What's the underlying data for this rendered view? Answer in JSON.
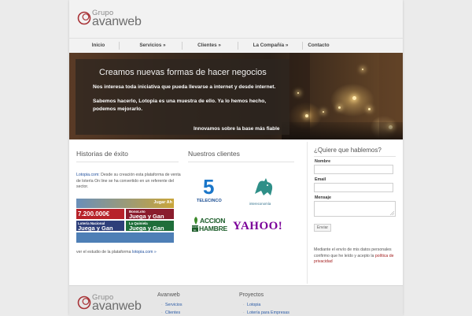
{
  "brand": {
    "line1": "Grupo",
    "line2": "avanweb"
  },
  "nav": [
    {
      "label": "Inicio"
    },
    {
      "label": "Servicios »"
    },
    {
      "label": "Clientes »"
    },
    {
      "label": "La Compañía »"
    },
    {
      "label": "Contacto"
    }
  ],
  "banner": {
    "title": "Creamos nuevas formas de hacer negocios",
    "line1": "Nos interesa toda iniciativa que pueda llevarse a internet y desde internet.",
    "line2": "Sabemos hacerlo, Lotopia es una muestra de ello. Ya lo hemos hecho,",
    "line3": "podemos mejorarlo.",
    "tagline": "Innovamos sobre la base más fiable"
  },
  "historias": {
    "heading": "Historias de éxito",
    "link": "Lotopia.com:",
    "text": " Desde su creación esta plataforma de venta de lotería On line se ha convertido en un referente del sector.",
    "tiles": {
      "t1": "Jugar Ah",
      "t2": "7.200.000€",
      "t3": "BonoLoto",
      "t4": "Juega y Gan",
      "t5": "Lotería Nacional",
      "t6": "Juega y Gan",
      "t7": "La Quiniela",
      "t8": "Juega y Gan"
    },
    "more_text": "ver el estudio de la plataforma ",
    "more_link": "lotopia.com »"
  },
  "clientes": {
    "heading": "Nuestros clientes",
    "logos": {
      "telecinco": "TELECINCO",
      "telecinco_num": "5",
      "intereconomia": "intereconomía",
      "accion": "ACCION",
      "hambre_prefix": "CONTRA EL",
      "hambre": "HAMBRE",
      "yahoo": "YAHOO!"
    }
  },
  "contact": {
    "heading": "¿Quiere que hablemos?",
    "nombre": "Nombre",
    "email": "Email",
    "mensaje": "Mensaje",
    "button": "Enviar",
    "privacy_text": "Mediante el envío de mis datos personales confirmo que he leído y acepto la ",
    "privacy_link": "política de privacidad"
  },
  "footer": {
    "brand1": "Grupo",
    "brand2": "avanweb",
    "col1_title": "Avanweb",
    "col1_items": [
      "Servicios",
      "Clientes"
    ],
    "col2_title": "Proyectos",
    "col2_items": [
      "Lotopia",
      "Lotería para Empresas"
    ]
  },
  "colors": {
    "link": "#1f4e9c",
    "privacy_link": "#a31d1d",
    "logo_red": "#a83236"
  }
}
